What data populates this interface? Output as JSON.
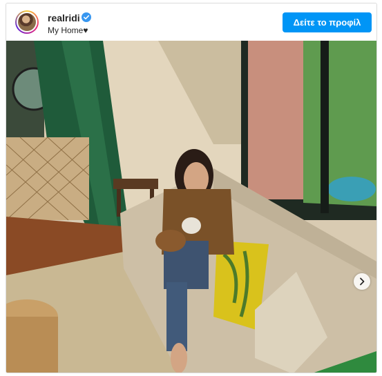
{
  "post": {
    "username": "realridi",
    "location": "My Home♥",
    "view_profile_label": "Δείτε το προφίλ"
  },
  "icons": {
    "verified": "verified-badge-icon",
    "next": "chevron-right-icon"
  },
  "colors": {
    "accent": "#0095f6",
    "verified": "#3897f0"
  }
}
